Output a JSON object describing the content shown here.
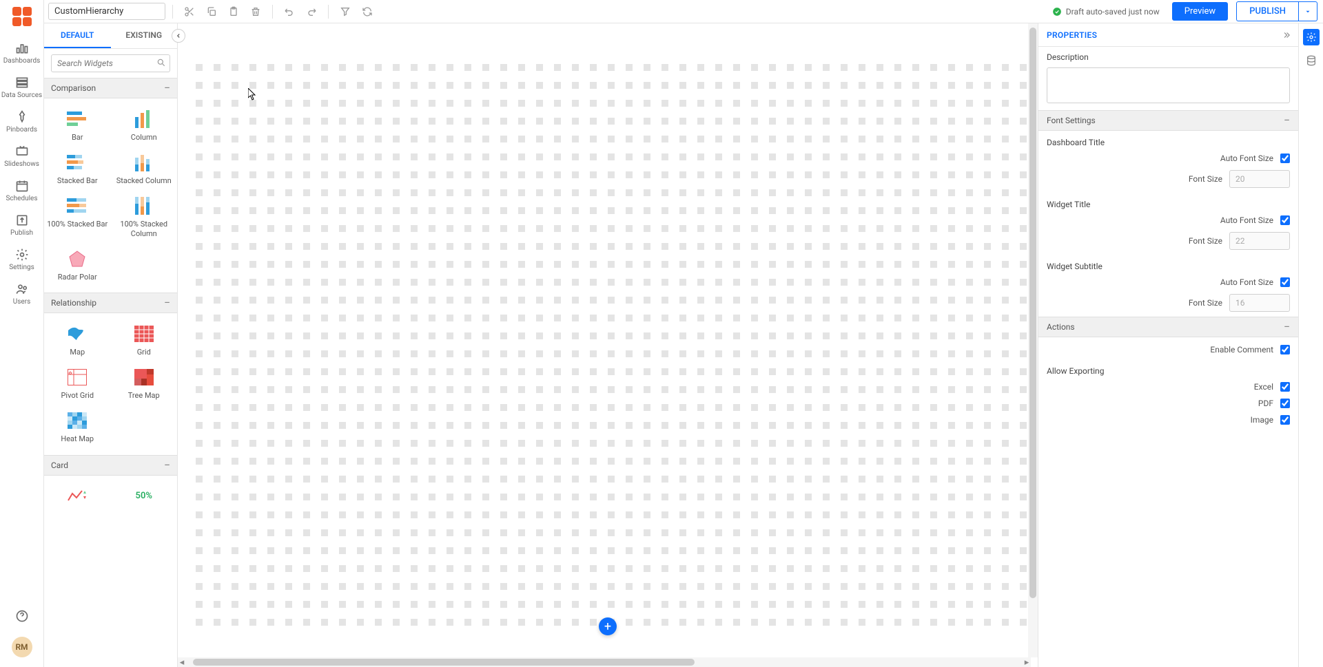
{
  "toolbar": {
    "title": "CustomHierarchy",
    "autosave": "Draft auto-saved just now",
    "preview": "Preview",
    "publish": "PUBLISH"
  },
  "left_rail": {
    "dashboards": "Dashboards",
    "data_sources": "Data Sources",
    "pinboards": "Pinboards",
    "slideshows": "Slideshows",
    "schedules": "Schedules",
    "publish": "Publish",
    "settings": "Settings",
    "users": "Users",
    "avatar": "RM"
  },
  "widgets": {
    "tab_default": "DEFAULT",
    "tab_existing": "EXISTING",
    "search_placeholder": "Search Widgets",
    "sections": {
      "comparison": {
        "title": "Comparison",
        "bar": "Bar",
        "column": "Column",
        "stacked_bar": "Stacked Bar",
        "stacked_column": "Stacked Column",
        "pct_bar": "100% Stacked Bar",
        "pct_column": "100% Stacked Column",
        "radar": "Radar Polar"
      },
      "relationship": {
        "title": "Relationship",
        "map": "Map",
        "grid": "Grid",
        "pivot": "Pivot Grid",
        "treemap": "Tree Map",
        "heatmap": "Heat Map"
      },
      "card": {
        "title": "Card",
        "fifty": "50%"
      }
    }
  },
  "properties": {
    "title": "PROPERTIES",
    "description": "Description",
    "font_settings": "Font Settings",
    "dashboard_title": "Dashboard Title",
    "widget_title": "Widget Title",
    "widget_subtitle": "Widget Subtitle",
    "auto_font": "Auto Font Size",
    "font_size": "Font Size",
    "fs_dashboard": "20",
    "fs_widget": "22",
    "fs_subtitle": "16",
    "actions": "Actions",
    "enable_comment": "Enable Comment",
    "allow_exporting": "Allow Exporting",
    "excel": "Excel",
    "pdf": "PDF",
    "image": "Image"
  }
}
